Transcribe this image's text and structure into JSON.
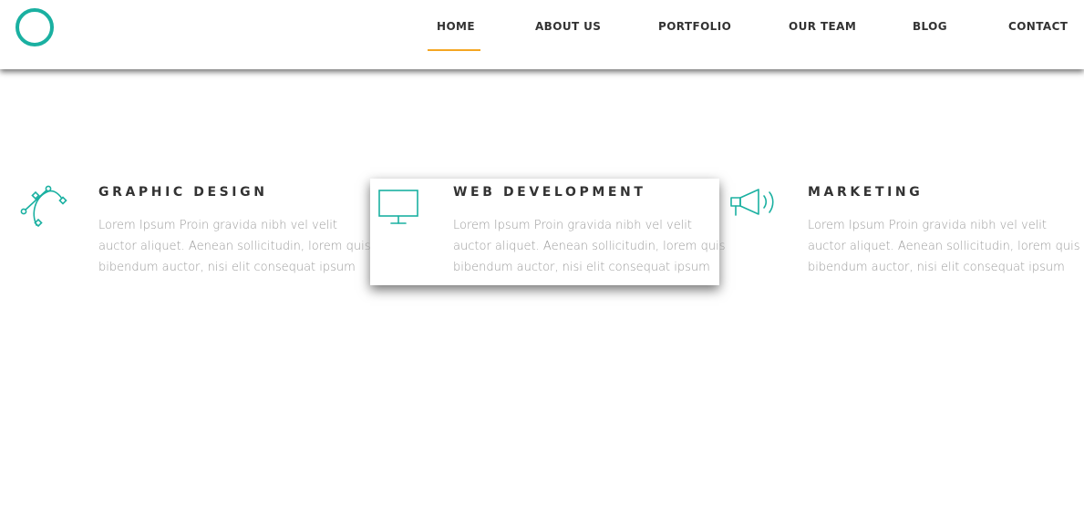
{
  "brand": {
    "accent_color": "#1ab0a1",
    "active_underline_color": "#f4a623",
    "logo_icon": "ring-logo"
  },
  "nav": {
    "items": [
      {
        "label": "HOME",
        "active": true
      },
      {
        "label": "ABOUT US",
        "active": false
      },
      {
        "label": "PORTFOLIO",
        "active": false
      },
      {
        "label": "OUR TEAM",
        "active": false
      },
      {
        "label": "BLOG",
        "active": false
      },
      {
        "label": "CONTACT",
        "active": false
      }
    ]
  },
  "features": [
    {
      "icon": "bezier-pen-icon",
      "title": "GRAPHIC DESIGN",
      "lines": [
        "Lorem Ipsum Proin gravida nibh vel velit",
        "auctor aliquet. Aenean sollicitudin, lorem quis",
        "bibendum auctor, nisi elit consequat ipsum"
      ],
      "highlighted": false
    },
    {
      "icon": "monitor-icon",
      "title": "WEB DEVELOPMENT",
      "lines": [
        "Lorem Ipsum Proin gravida nibh vel velit",
        "auctor aliquet. Aenean sollicitudin, lorem quis",
        "bibendum auctor, nisi elit consequat ipsum"
      ],
      "highlighted": true
    },
    {
      "icon": "megaphone-icon",
      "title": "MARKETING",
      "lines": [
        "Lorem Ipsum Proin gravida nibh vel velit",
        "auctor aliquet. Aenean sollicitudin, lorem quis",
        "bibendum auctor, nisi elit consequat ipsum"
      ],
      "highlighted": false
    }
  ]
}
